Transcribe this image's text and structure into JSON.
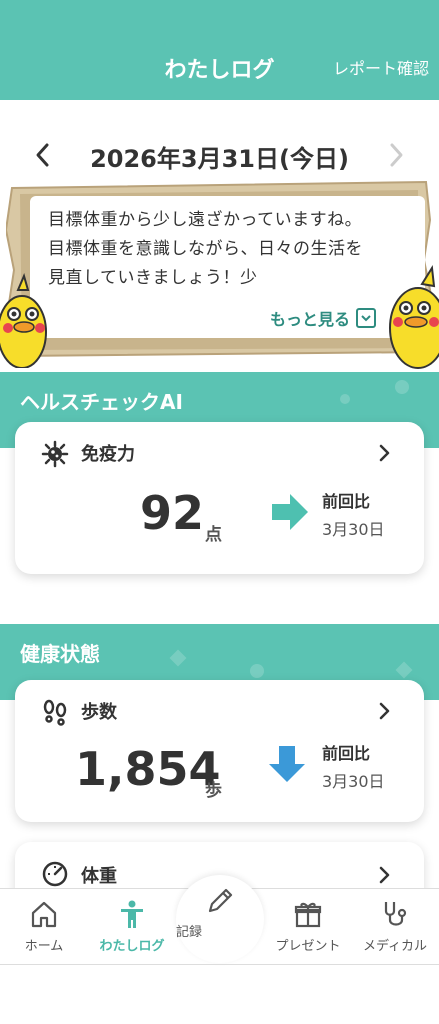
{
  "header": {
    "title": "わたしログ",
    "report_link": "レポート確認"
  },
  "date_nav": {
    "date": "2026年3月31日(今日)"
  },
  "message": {
    "text": "目標体重から少し遠ざかっていますね。目標体重を意識しながら、日々の生活を見直していきましょう！少",
    "more_label": "もっと見る"
  },
  "health_check": {
    "section_title": "ヘルスチェックAI",
    "card": {
      "title": "免疫力",
      "value": "92",
      "unit": "点",
      "compare_label": "前回比",
      "compare_date": "3月30日",
      "trend": "up"
    }
  },
  "health_status": {
    "section_title": "健康状態",
    "steps_card": {
      "title": "歩数",
      "value": "1,854",
      "unit": "歩",
      "compare_label": "前回比",
      "compare_date": "3月30日",
      "trend": "down"
    },
    "weight_card": {
      "title": "体重"
    }
  },
  "bottom_nav": {
    "items": [
      {
        "label": "ホーム",
        "icon": "home-icon"
      },
      {
        "label": "わたしログ",
        "icon": "person-icon",
        "active": true
      },
      {
        "label": "記録",
        "icon": "pencil-icon"
      },
      {
        "label": "プレゼント",
        "icon": "gift-icon"
      },
      {
        "label": "メディカル",
        "icon": "stethoscope-icon"
      }
    ]
  },
  "colors": {
    "primary": "#5bc3b3",
    "accent_text": "#2e8c80",
    "up_arrow": "#4ec0b0",
    "down_arrow": "#3b99d8",
    "board_wood": "#d9c8a4"
  }
}
